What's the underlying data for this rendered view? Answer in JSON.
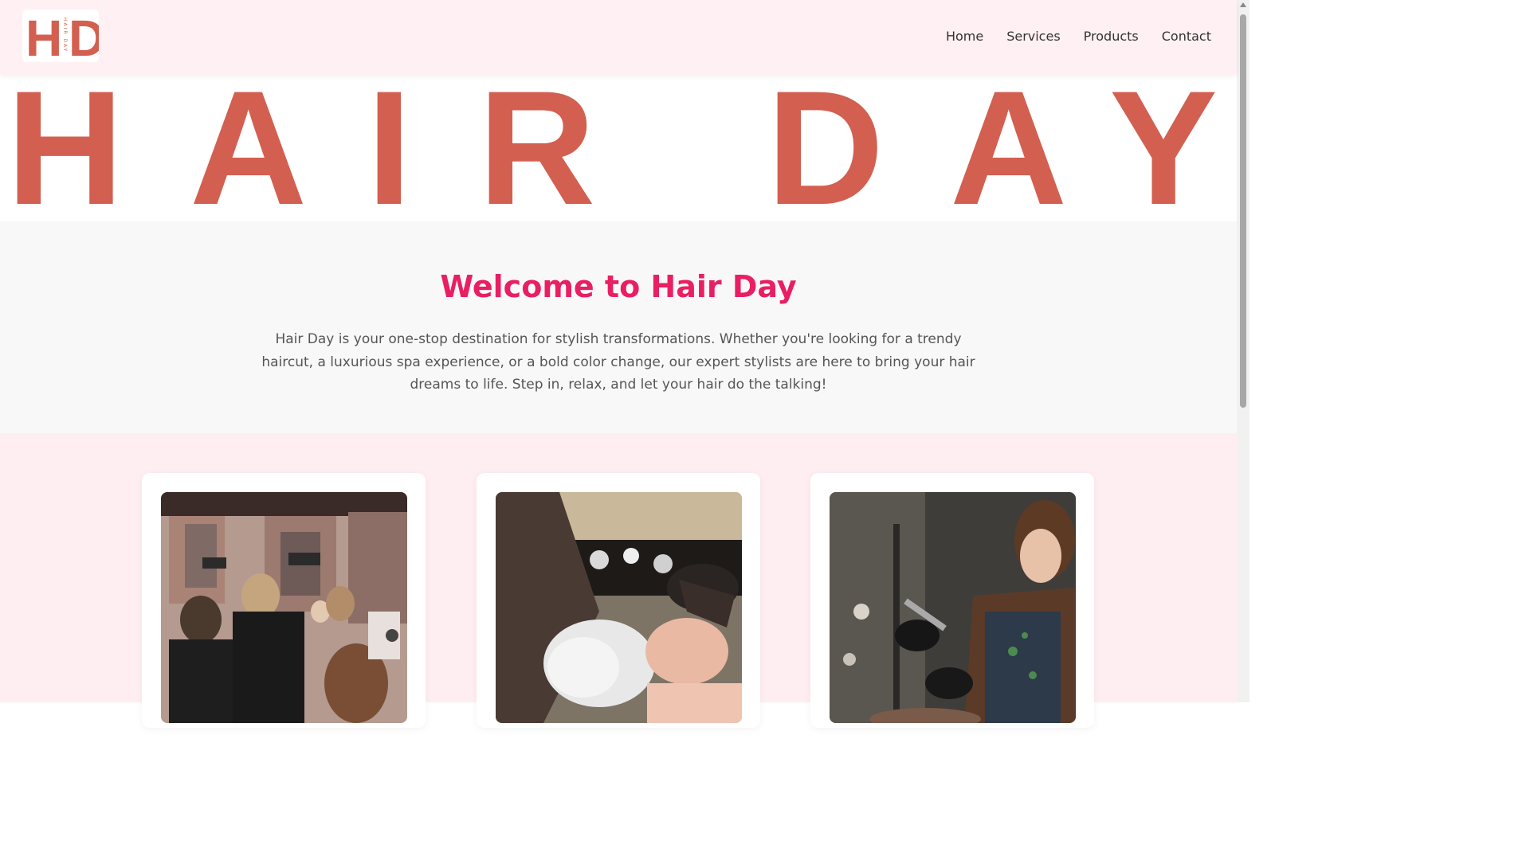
{
  "header": {
    "logo": {
      "letter_left": "H",
      "letter_right": "D",
      "vertical_text": "HAIR DAY"
    },
    "nav": [
      {
        "label": "Home"
      },
      {
        "label": "Services"
      },
      {
        "label": "Products"
      },
      {
        "label": "Contact"
      }
    ]
  },
  "hero": {
    "letters": [
      "H",
      "A",
      "I",
      "R",
      "D",
      "A",
      "Y"
    ]
  },
  "welcome": {
    "title": "Welcome to Hair Day",
    "body": "Hair Day is your one-stop destination for stylish transformations. Whether you're looking for a trendy haircut, a luxurious spa experience, or a bold color change, our expert stylists are here to bring your hair dreams to life. Step in, relax, and let your hair do the talking!"
  },
  "services": {
    "cards": [
      {
        "image": "salon-stylists-styling-hair-photo"
      },
      {
        "image": "hair-washing-shampoo-photo"
      },
      {
        "image": "stylist-coloring-hair-photo"
      }
    ]
  },
  "colors": {
    "accent_brand": "#d35f50",
    "title_pink": "#e91e63",
    "header_bg": "#fff0f3",
    "section_pink_bg": "#ffeef1",
    "welcome_bg": "#f8f8f8"
  }
}
